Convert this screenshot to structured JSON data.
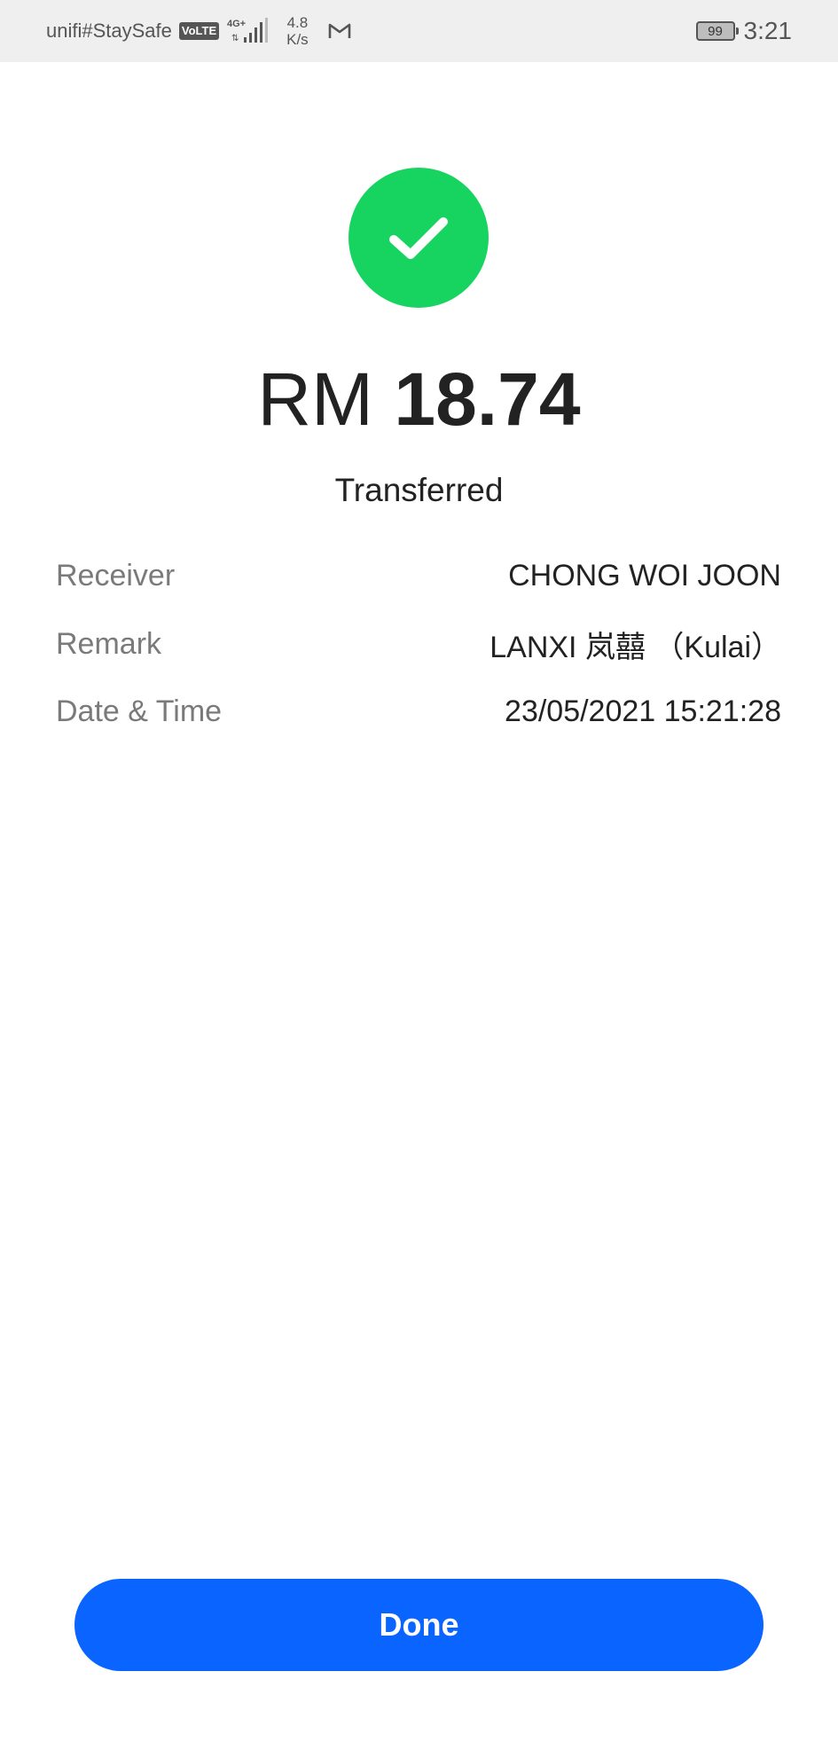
{
  "status_bar": {
    "carrier": "unifi#StaySafe",
    "volte": "VoLTE",
    "network_type": "4G+",
    "speed_value": "4.8",
    "speed_unit": "K/s",
    "battery": "99",
    "time": "3:21"
  },
  "receipt": {
    "currency": "RM",
    "amount": "18.74",
    "status": "Transferred",
    "details": [
      {
        "label": "Receiver",
        "value": "CHONG WOI JOON"
      },
      {
        "label": "Remark",
        "value": "LANXI 岚囍 （Kulai）"
      },
      {
        "label": "Date & Time",
        "value": "23/05/2021 15:21:28"
      }
    ]
  },
  "actions": {
    "done_label": "Done"
  },
  "colors": {
    "success": "#16d45f",
    "primary": "#0a64ff"
  }
}
